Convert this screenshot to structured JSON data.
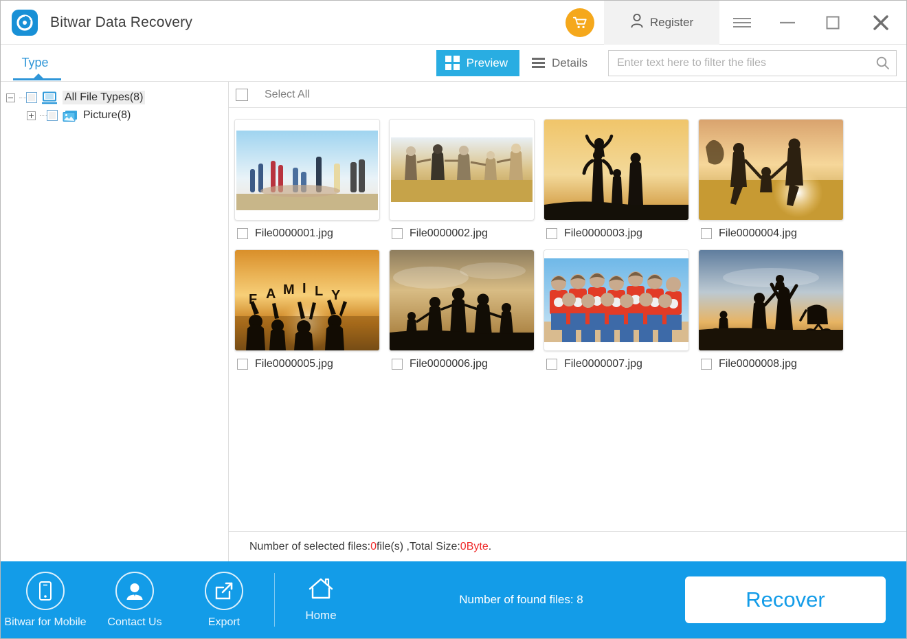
{
  "window": {
    "app_title": "Bitwar Data Recovery",
    "logo_icon": "bitwar-logo-icon",
    "cart_icon": "shopping-cart-icon",
    "register_label": "Register",
    "register_icon": "user-icon",
    "menu_icon": "hamburger-menu-icon",
    "minimize_icon": "minimize-icon",
    "maximize_icon": "maximize-icon",
    "close_icon": "close-icon",
    "accent_blue": "#139ce8",
    "tab_blue": "#2f96d8",
    "cart_orange": "#f5a81c"
  },
  "toolbar": {
    "type_tab_label": "Type",
    "preview_label": "Preview",
    "preview_icon": "grid-view-icon",
    "details_label": "Details",
    "details_icon": "list-view-icon",
    "search_placeholder": "Enter text here to filter the files",
    "search_value": "",
    "search_icon": "search-icon"
  },
  "sidebar": {
    "tree": [
      {
        "label": "All File Types(8)",
        "icon": "computer-icon",
        "expander": "minus",
        "selected": true
      },
      {
        "label": "Picture(8)",
        "icon": "picture-icon",
        "expander": "plus",
        "selected": false
      }
    ]
  },
  "filepane": {
    "select_all_label": "Select All",
    "files": [
      {
        "name": "File0000001.jpg",
        "art": "kids-field"
      },
      {
        "name": "File0000002.jpg",
        "art": "holding-hands-gold"
      },
      {
        "name": "File0000003.jpg",
        "art": "sunset-family-silhouette"
      },
      {
        "name": "File0000004.jpg",
        "art": "sunset-swing-child"
      },
      {
        "name": "File0000005.jpg",
        "art": "family-letters-sunset"
      },
      {
        "name": "File0000006.jpg",
        "art": "family-hands-silhouette"
      },
      {
        "name": "File0000007.jpg",
        "art": "red-shirt-group"
      },
      {
        "name": "File0000008.jpg",
        "art": "beach-family-silhouette"
      }
    ],
    "status_prefix": "Number of selected files: ",
    "status_count": "0",
    "status_middle": "file(s) ,Total Size: ",
    "status_size": "0Byte",
    "status_suffix": "."
  },
  "bottombar": {
    "mobile_label": "Bitwar for Mobile",
    "mobile_icon": "mobile-phone-icon",
    "contact_label": "Contact Us",
    "contact_icon": "person-icon",
    "export_label": "Export",
    "export_icon": "export-arrow-icon",
    "home_label": "Home",
    "home_icon": "home-icon",
    "found_files_text": "Number of found files: 8",
    "recover_label": "Recover"
  }
}
